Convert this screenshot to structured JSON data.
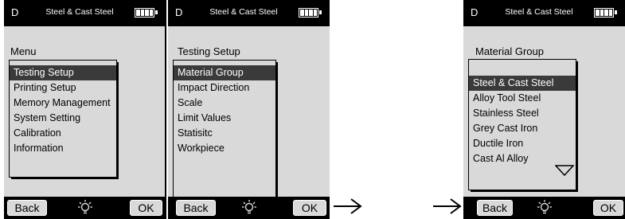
{
  "screens": [
    {
      "mode": "D",
      "material": "Steel & Cast Steel",
      "title": "Menu",
      "items": [
        "Testing Setup",
        "Printing Setup",
        "Memory Management",
        "System Setting",
        "Calibration",
        "Information"
      ],
      "selected_index": 0,
      "left_softkey": "Back",
      "right_softkey": "OK"
    },
    {
      "mode": "D",
      "material": "Steel & Cast Steel",
      "title": "Testing Setup",
      "items": [
        "Material Group",
        "Impact Direction",
        "Scale",
        "Limit Values",
        "Statisitc",
        "Workpiece"
      ],
      "selected_index": 0,
      "left_softkey": "Back",
      "right_softkey": "OK"
    },
    {
      "mode": "D",
      "material": "Steel & Cast Steel",
      "title": "Material Group",
      "items": [
        "Steel & Cast Steel",
        "Alloy Tool Steel",
        "Stainless Steel",
        "Grey Cast Iron",
        "Ductile Iron",
        "Cast Al Alloy"
      ],
      "selected_index": 0,
      "left_softkey": "Back",
      "right_softkey": "OK"
    }
  ],
  "icons": {
    "battery": "battery-full-icon",
    "backlight": "lightbulb-icon",
    "scroll_down": "triangle-down-icon",
    "arrow": "right-arrow-icon"
  },
  "colors": {
    "bar": "#000000",
    "screen_bg": "#d9d9d9",
    "selection": "#3a3a3a"
  }
}
